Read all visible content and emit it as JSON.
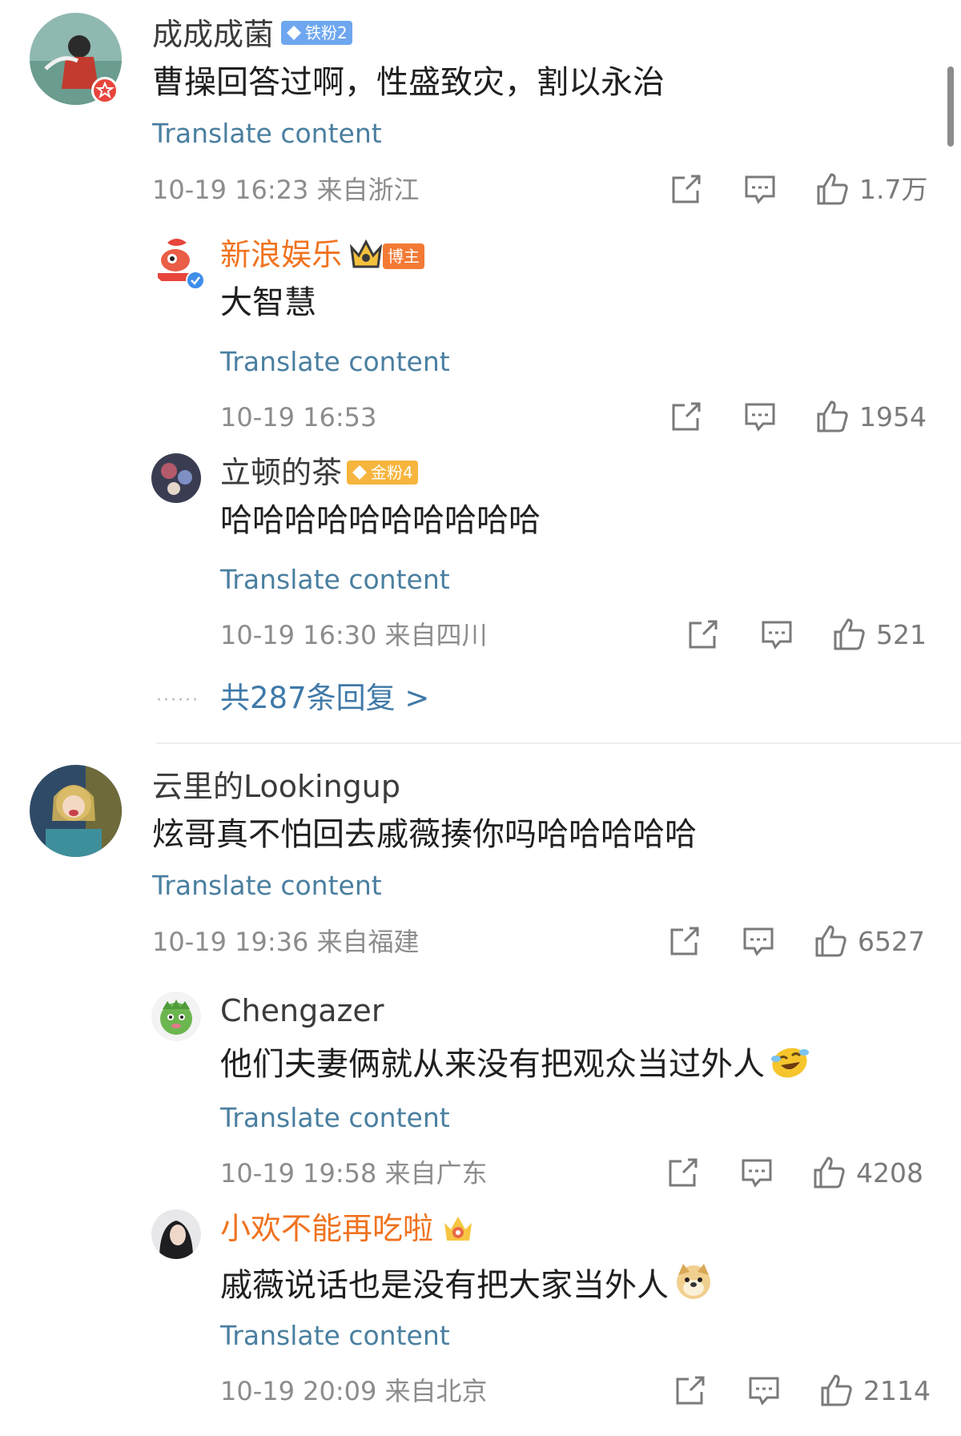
{
  "comments": [
    {
      "user": "成成成菌",
      "badge": "铁粉2",
      "text": "曹操回答过啊，性盛致灾，割以永治",
      "translate": "Translate content",
      "time": "10-19 16:23 来自浙江",
      "likes": "1.7万",
      "replies": [
        {
          "user": "新浪娱乐",
          "badge": "博主",
          "text": "大智慧",
          "translate": "Translate content",
          "time": "10-19 16:53",
          "likes": "1954"
        },
        {
          "user": "立顿的茶",
          "badge": "金粉4",
          "text": "哈哈哈哈哈哈哈哈哈哈",
          "translate": "Translate content",
          "time": "10-19 16:30 来自四川",
          "likes": "521"
        }
      ],
      "more_replies": "共287条回复 >"
    },
    {
      "user": "云里的Lookingup",
      "text": "炫哥真不怕回去戚薇揍你吗哈哈哈哈哈",
      "translate": "Translate content",
      "time": "10-19 19:36 来自福建",
      "likes": "6527",
      "replies": [
        {
          "user": "Chengazer",
          "text": "他们夫妻俩就从来没有把观众当过外人",
          "emoji": "laughing-crying-emoji",
          "translate": "Translate content",
          "time": "10-19 19:58 来自广东",
          "likes": "4208"
        },
        {
          "user": "小欢不能再吃啦",
          "text": "戚薇说话也是没有把大家当外人",
          "emoji": "doge-emoji",
          "translate": "Translate content",
          "time": "10-19 20:09 来自北京",
          "likes": "2114"
        }
      ]
    }
  ],
  "icons": {
    "share": "share-icon",
    "reply": "comment-icon",
    "like": "thumbs-up-icon"
  },
  "colors": {
    "link": "#4a7fa0",
    "vip_name": "#f0731f",
    "meta": "#8c8c8c"
  }
}
